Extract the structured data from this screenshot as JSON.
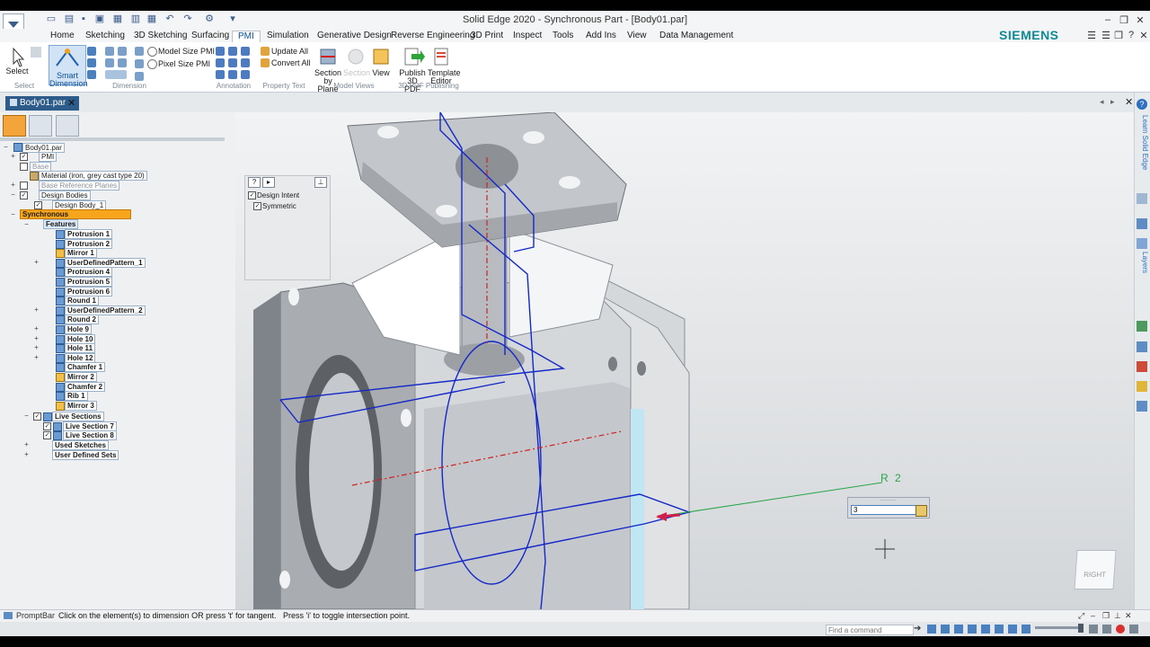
{
  "app": {
    "title": "Solid Edge 2020 - Synchronous Part - [Body01.par]",
    "brand": "SIEMENS"
  },
  "ribbon_tabs": [
    "Home",
    "Sketching",
    "3D Sketching",
    "Surfacing",
    "PMI",
    "Simulation",
    "Generative Design",
    "Reverse Engineering",
    "3D Print",
    "Inspect",
    "Tools",
    "Add Ins",
    "View",
    "Data Management"
  ],
  "active_tab": "PMI",
  "ribbon": {
    "select": "Select",
    "smart_dimension_1": "Smart",
    "smart_dimension_2": "Dimension",
    "model_size_pmi": "Model Size PMI",
    "pixel_size_pmi": "Pixel Size PMI",
    "update_all": "Update All",
    "convert_all": "Convert All",
    "section_by_plane_1": "Section",
    "section_by_plane_2": "by Plane",
    "section": "Section",
    "view": "View",
    "publish_1": "Publish",
    "publish_2": "3D PDF",
    "template_1": "Template",
    "template_2": "Editor",
    "groups": {
      "select": "Select",
      "dimension": "Dimension",
      "annotation": "Annotation",
      "property_text": "Property Text",
      "model_views": "Model Views",
      "publishing": "3D PDF Publishing"
    }
  },
  "document_tab": "Body01.par",
  "tree": {
    "root": "Body01.par",
    "pmi": "PMI",
    "base": "Base",
    "material": "Material (iron, grey cast type 20)",
    "base_ref_planes": "Base Reference Planes",
    "design_bodies": "Design Bodies",
    "design_body_1": "Design Body_1",
    "synchronous": "Synchronous",
    "features": "Features",
    "feature_items": [
      "Protrusion 1",
      "Protrusion 2",
      "Mirror 1",
      "UserDefinedPattern_1",
      "Protrusion 4",
      "Protrusion 5",
      "Protrusion 6",
      "Round 1",
      "UserDefinedPattern_2",
      "Round 2",
      "Hole 9",
      "Hole 10",
      "Hole 11",
      "Hole 12",
      "Chamfer 1",
      "Mirror 2",
      "Chamfer 2",
      "Rib 1",
      "Mirror 3"
    ],
    "live_sections": "Live Sections",
    "live_section_items": [
      "Live Section 7",
      "Live Section 8"
    ],
    "used_sketches": "Used Sketches",
    "user_defined_sets": "User Defined Sets"
  },
  "design_intent": {
    "title": "Design Intent",
    "symmetric": "Symmetric"
  },
  "viewport": {
    "dimension_label": "R 2",
    "dimension_value": "3",
    "view_cube_label": "RIGHT",
    "learn_panel": "Learn Solid Edge",
    "layers_panel": "Layers"
  },
  "prompt": {
    "label": "PromptBar",
    "text": "Click on the element(s) to dimension OR press 't' for tangent.   Press 'i' to toggle intersection point."
  },
  "status": {
    "find_placeholder": "Find a command"
  },
  "colors": {
    "accent": "#2e5c8a",
    "brand": "#0c8a96",
    "section_line": "#1428c8",
    "highlight": "#f7a51c"
  }
}
